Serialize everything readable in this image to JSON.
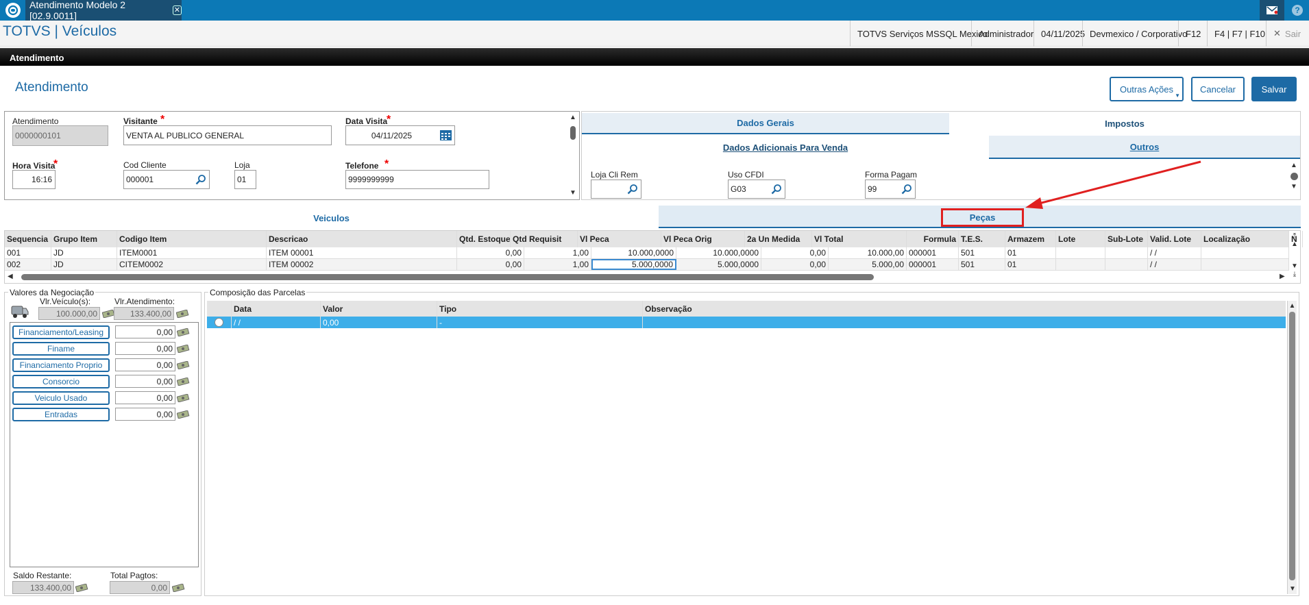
{
  "window": {
    "tab_title": "Atendimento Modelo 2 [02.9.0011]",
    "close_symbol": "✕",
    "mail_icon": "envelope-icon",
    "help_symbol": "?"
  },
  "app": {
    "title": "TOTVS | Veículos"
  },
  "statusbar": {
    "env": "TOTVS Serviços MSSQL Mexico",
    "user": "Administrador",
    "date": "04/11/2025",
    "company": "Devmexico / Corporativo",
    "f12": "F12",
    "fkeys": "F4 | F7 | F10",
    "exit": "Sair",
    "exit_symbol": "✕"
  },
  "section": {
    "header": "Atendimento"
  },
  "page": {
    "title": "Atendimento"
  },
  "actions": {
    "other": "Outras Ações",
    "cancel": "Cancelar",
    "save": "Salvar"
  },
  "form": {
    "atendimento": {
      "label": "Atendimento",
      "value": "0000000101"
    },
    "visitante": {
      "label": "Visitante",
      "value": "VENTA AL PUBLICO GENERAL"
    },
    "data_visita": {
      "label": "Data Visita",
      "value": "04/11/2025"
    },
    "hora_visita": {
      "label": "Hora Visita",
      "value": "16:16"
    },
    "cod_cliente": {
      "label": "Cod Cliente",
      "value": "000001"
    },
    "loja": {
      "label": "Loja",
      "value": "01"
    },
    "telefone": {
      "label": "Telefone",
      "value": "9999999999"
    },
    "required_mark": "*"
  },
  "right_tabs": {
    "row1": [
      "Dados Gerais",
      "Impostos"
    ],
    "row2": [
      "Dados Adicionais Para Venda",
      "Outros"
    ]
  },
  "outros": {
    "loja_cli_rem": {
      "label": "Loja Cli Rem",
      "value": ""
    },
    "uso_cfdi": {
      "label": "Uso CFDI",
      "value": "G03"
    },
    "forma_pagam": {
      "label": "Forma Pagam",
      "value": "99"
    }
  },
  "mid_tabs": [
    "Veiculos",
    "Peças"
  ],
  "items_grid": {
    "headers": [
      "Sequencia",
      "Grupo Item",
      "Codigo Item",
      "Descricao",
      "Qtd. Estoque",
      "Qtd Requisit",
      "Vl Peca",
      "Vl Peca Orig",
      "2a Un Medida",
      "Vl Total",
      "Formula",
      "T.E.S.",
      "Armazem",
      "Lote",
      "Sub-Lote",
      "Valid. Lote",
      "Localização",
      "N"
    ],
    "rows": [
      [
        "001",
        "JD",
        "ITEM0001",
        "ITEM 00001",
        "0,00",
        "1,00",
        "10.000,0000",
        "10.000,0000",
        "0,00",
        "10.000,00",
        "000001",
        "501",
        "01",
        "",
        "",
        "/ /",
        "",
        ""
      ],
      [
        "002",
        "JD",
        "CITEM0002",
        "ITEM 00002",
        "0,00",
        "1,00",
        "5.000,0000",
        "5.000,0000",
        "0,00",
        "5.000,00",
        "000001",
        "501",
        "01",
        "",
        "",
        "/ /",
        "",
        ""
      ]
    ]
  },
  "negociacao": {
    "title": "Valores da Negociação",
    "vlr_veiculo_label": "Vlr.Veículo(s):",
    "vlr_veiculo": "100.000,00",
    "vlr_atend_label": "Vlr.Atendimento:",
    "vlr_atend": "133.400,00",
    "items": [
      {
        "label": "Financiamento/Leasing",
        "value": "0,00"
      },
      {
        "label": "Finame",
        "value": "0,00"
      },
      {
        "label": "Financiamento Proprio",
        "value": "0,00"
      },
      {
        "label": "Consorcio",
        "value": "0,00"
      },
      {
        "label": "Veiculo Usado",
        "value": "0,00"
      },
      {
        "label": "Entradas",
        "value": "0,00"
      }
    ],
    "saldo_label": "Saldo Restante:",
    "saldo": "133.400,00",
    "total_label": "Total Pagtos:",
    "total": "0,00"
  },
  "parcelas": {
    "title": "Composição das Parcelas",
    "headers": [
      "Data",
      "Valor",
      "Tipo",
      "Observação"
    ],
    "rows": [
      [
        "/ /",
        "0,00",
        "-",
        ""
      ]
    ]
  },
  "scroll": {
    "up": "▲",
    "down": "▼",
    "left": "◀",
    "right": "▶",
    "first": "⤒",
    "last": "⤓"
  },
  "colors": {
    "primary": "#1d6aa5",
    "topbar": "#0c79b6",
    "highlight": "#e02020",
    "selected_row": "#3daee9"
  }
}
